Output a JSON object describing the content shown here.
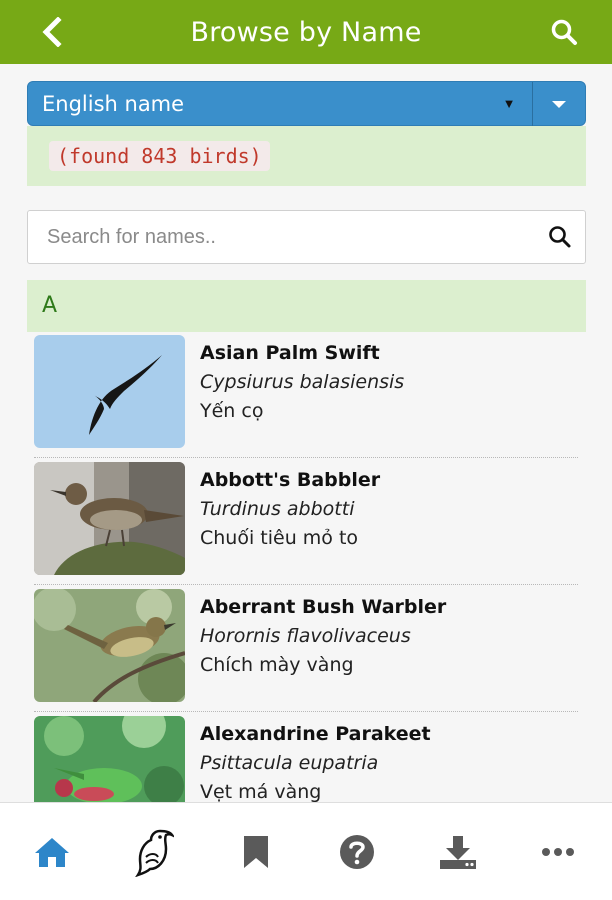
{
  "header": {
    "title": "Browse by Name",
    "back_icon": "chevron-left-icon",
    "search_icon": "search-icon",
    "bg_color": "#77a916"
  },
  "name_select": {
    "selected": "English name",
    "color": "#3a8fcb"
  },
  "found_text": "(found 843 birds)",
  "search": {
    "placeholder": "Search for names.."
  },
  "section_letter": "A",
  "birds": [
    {
      "english": "Asian Palm Swift",
      "scientific": "Cypsiurus balasiensis",
      "vietnamese": "Yến cọ"
    },
    {
      "english": "Abbott's Babbler",
      "scientific": "Turdinus abbotti",
      "vietnamese": "Chuối tiêu mỏ to"
    },
    {
      "english": "Aberrant Bush Warbler",
      "scientific": "Horornis flavolivaceus",
      "vietnamese": "Chích mày vàng"
    },
    {
      "english": "Alexandrine Parakeet",
      "scientific": "Psittacula eupatria",
      "vietnamese": "Vẹt má vàng"
    }
  ],
  "bottom_nav": [
    {
      "icon": "home-icon",
      "active": true
    },
    {
      "icon": "bird-icon",
      "active": false
    },
    {
      "icon": "bookmark-icon",
      "active": false
    },
    {
      "icon": "help-icon",
      "active": false
    },
    {
      "icon": "download-icon",
      "active": false
    },
    {
      "icon": "more-icon",
      "active": false
    }
  ],
  "colors": {
    "active_nav": "#2d86c9",
    "inactive_nav": "#5a5a5a",
    "section_bg": "#dcefcf",
    "section_text": "#2f7a1a"
  }
}
